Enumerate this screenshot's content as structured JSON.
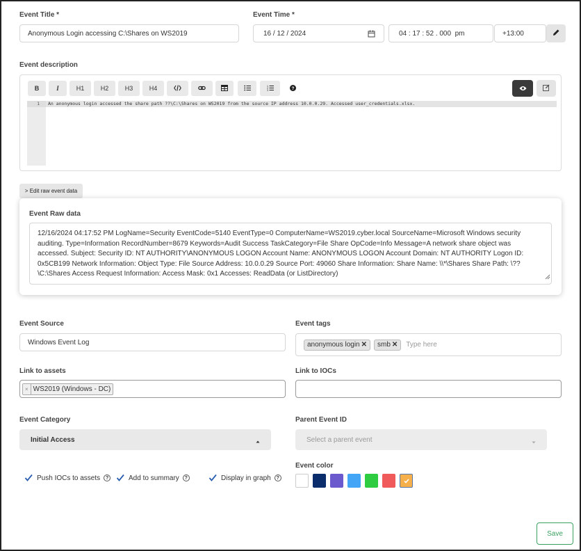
{
  "event_title": {
    "label": "Event Title *",
    "value": "Anonymous Login accessing C:\\Shares on WS2019"
  },
  "event_time": {
    "label": "Event Time *",
    "date": "16 / 12 / 2024",
    "time": "04 : 17 : 52 . 000  pm",
    "timezone": "+13:00"
  },
  "description": {
    "label": "Event description",
    "toolbar": {
      "bold": "B",
      "italic": "I",
      "h1": "H1",
      "h2": "H2",
      "h3": "H3",
      "h4": "H4"
    },
    "line_number": "1",
    "text": "An anonymous login accessed the share path ??\\C:\\Shares on WS2019 from the source IP address 10.0.0.29. Accessed user_credentials.xlsx."
  },
  "raw": {
    "toggle_label": "> Edit raw event data",
    "label": "Event Raw data",
    "text": "12/16/2024 04:17:52 PM LogName=Security EventCode=5140 EventType=0 ComputerName=WS2019.cyber.local SourceName=Microsoft Windows security auditing. Type=Information RecordNumber=8679 Keywords=Audit Success TaskCategory=File Share OpCode=Info Message=A network share object was accessed. Subject: Security ID: NT AUTHORITY\\ANONYMOUS LOGON Account Name: ANONYMOUS LOGON Account Domain: NT AUTHORITY Logon ID: 0x5CB199 Network Information: Object Type: File Source Address: 10.0.0.29 Source Port: 49060 Share Information: Share Name: \\\\*\\Shares Share Path: \\??\\C:\\Shares Access Request Information: Access Mask: 0x1 Accesses: ReadData (or ListDirectory)"
  },
  "event_source": {
    "label": "Event Source",
    "value": "Windows Event Log"
  },
  "event_tags": {
    "label": "Event tags",
    "tags": [
      "anonymous login",
      "smb"
    ],
    "placeholder": "Type here"
  },
  "link_assets": {
    "label": "Link to assets",
    "asset": "WS2019 (Windows - DC)"
  },
  "link_iocs": {
    "label": "Link to IOCs"
  },
  "event_category": {
    "label": "Event Category",
    "value": "Initial Access"
  },
  "parent_event": {
    "label": "Parent Event ID",
    "placeholder": "Select a parent event"
  },
  "checkboxes": {
    "push_iocs": "Push IOCs to assets",
    "add_summary": "Add to summary",
    "display_graph": "Display in graph"
  },
  "event_color": {
    "label": "Event color",
    "colors": [
      "#ffffff",
      "#0c2d6b",
      "#6a5acd",
      "#42a5f5",
      "#2ecc40",
      "#f15a5a",
      "#f6b04b"
    ],
    "selected_index": 6
  },
  "save_label": "Save"
}
